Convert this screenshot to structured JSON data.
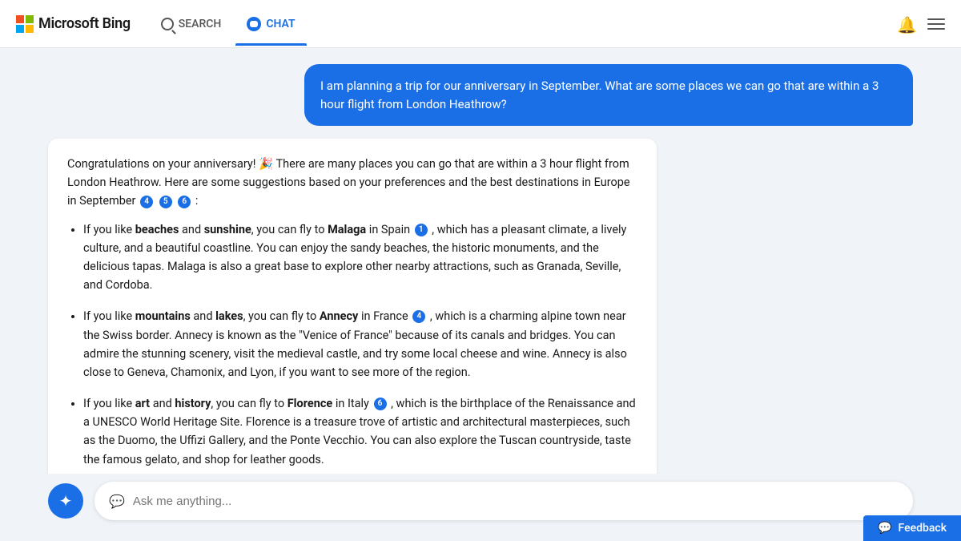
{
  "header": {
    "logo_text": "Microsoft Bing",
    "nav": [
      {
        "id": "search",
        "label": "SEARCH",
        "active": false
      },
      {
        "id": "chat",
        "label": "CHAT",
        "active": true
      }
    ]
  },
  "chat": {
    "user_message": "I am planning a trip for our anniversary in September. What are some places we can go that are within a 3 hour flight from London Heathrow?",
    "ai_intro": "Congratulations on your anniversary! 🎉 There are many places you can go that are within a 3 hour flight from London Heathrow. Here are some suggestions based on your preferences and the best destinations in Europe in September",
    "ai_intro_refs": [
      "4",
      "5",
      "6"
    ],
    "bullet_items": [
      {
        "intro": "If you like ",
        "bold1": "beaches",
        "connector1": " and ",
        "bold2": "sunshine",
        "rest1": ", you can fly to ",
        "destination": "Malaga",
        "location": " in Spain",
        "ref": "1",
        "description": ", which has a pleasant climate, a lively culture, and a beautiful coastline. You can enjoy the sandy beaches, the historic monuments, and the delicious tapas. Malaga is also a great base to explore other nearby attractions, such as Granada, Seville, and Cordoba."
      },
      {
        "intro": "If you like ",
        "bold1": "mountains",
        "connector1": " and ",
        "bold2": "lakes",
        "rest1": ", you can fly to ",
        "destination": "Annecy",
        "location": " in France",
        "ref": "4",
        "description": ", which is a charming alpine town near the Swiss border. Annecy is known as the \"Venice of France\" because of its canals and bridges. You can admire the stunning scenery, visit the medieval castle, and try some local cheese and wine. Annecy is also close to Geneva, Chamonix, and Lyon, if you want to see more of the region."
      },
      {
        "intro": "If you like ",
        "bold1": "art",
        "connector1": " and ",
        "bold2": "history",
        "rest1": ", you can fly to ",
        "destination": "Florence",
        "location": " in Italy",
        "ref": "6",
        "description": ", which is the birthplace of the Renaissance and a UNESCO World Heritage Site. Florence is a treasure trove of artistic and architectural masterpieces, such as the Duomo, the Uffizi Gallery, and the Ponte Vecchio. You can also explore the Tuscan countryside, taste the famous gelato, and shop for leather goods."
      }
    ]
  },
  "input": {
    "placeholder": "Ask me anything..."
  },
  "feedback": {
    "label": "Feedback"
  }
}
